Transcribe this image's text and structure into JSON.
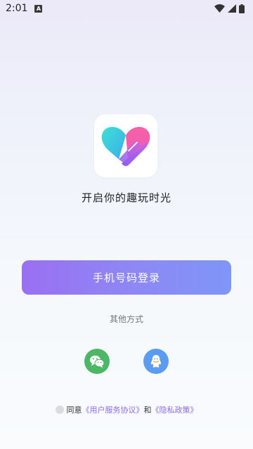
{
  "status_bar": {
    "time": "2:01",
    "notification_badge": "A",
    "icons": [
      "wifi-icon",
      "signal-icon",
      "battery-icon"
    ]
  },
  "app": {
    "tagline": "开启你的趣玩时光",
    "login_button": "手机号码登录",
    "other_methods": "其他方式",
    "social_logins": [
      "wechat-icon",
      "qq-icon"
    ]
  },
  "agreement": {
    "prefix": "同意",
    "user_agreement": "《用户服务协议》",
    "conjunction": "和",
    "privacy_policy": "《隐私政策》"
  },
  "colors": {
    "button_gradient_start": "#9A6FF2",
    "button_gradient_end": "#7E96F7",
    "link": "#8B6CE8",
    "wechat": "#4CB865",
    "qq": "#5B9BF2",
    "logo_cyan": "#3FD8DF",
    "logo_pink": "#F25FA8"
  }
}
